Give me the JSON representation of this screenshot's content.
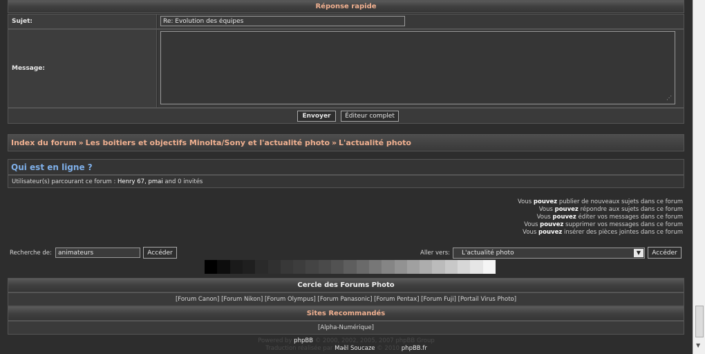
{
  "quick_reply": {
    "title": "Réponse rapide",
    "subject_label": "Sujet:",
    "subject_value": "Re: Evolution des équipes",
    "message_label": "Message:",
    "message_value": "",
    "send_label": "Envoyer",
    "full_editor_label": "Éditeur complet"
  },
  "breadcrumb": {
    "items": [
      "Index du forum",
      "Les boitiers et objectifs Minolta/Sony et l'actualité photo",
      "L'actualité photo"
    ],
    "separator": "»"
  },
  "online": {
    "title": "Qui est en ligne ?",
    "text_prefix": "Utilisateur(s) parcourant ce forum :",
    "users": "Henry 67, pmai",
    "text_suffix": "and 0 invités"
  },
  "permissions": [
    {
      "pre": "Vous",
      "strong": "pouvez",
      "post": "publier de nouveaux sujets dans ce forum"
    },
    {
      "pre": "Vous",
      "strong": "pouvez",
      "post": "répondre aux sujets dans ce forum"
    },
    {
      "pre": "Vous",
      "strong": "pouvez",
      "post": "éditer vos messages dans ce forum"
    },
    {
      "pre": "Vous",
      "strong": "pouvez",
      "post": "supprimer vos messages dans ce forum"
    },
    {
      "pre": "Vous",
      "strong": "pouvez",
      "post": "insérer des pièces jointes dans ce forum"
    }
  ],
  "search": {
    "label": "Recherche de:",
    "value": "animateurs",
    "button": "Accéder"
  },
  "jump": {
    "label": "Aller vers:",
    "selected": "L'actualité photo",
    "button": "Accéder"
  },
  "grayscale": [
    "#000000",
    "#0d0d0d",
    "#1a1a1a",
    "#1f1f1f",
    "#2a2a2a",
    "#303030",
    "#383838",
    "#3d3d3d",
    "#444444",
    "#4a4a4a",
    "#525252",
    "#5e5e5e",
    "#6a6a6a",
    "#777777",
    "#858585",
    "#929292",
    "#a0a0a0",
    "#adadad",
    "#bbbbbb",
    "#c8c8c8",
    "#d7d7d7",
    "#e6e6e6",
    "#f5f5f5"
  ],
  "cercle": {
    "title": "Cercle des Forums Photo",
    "links": [
      "[Forum Canon]",
      "[Forum Nikon]",
      "[Forum Olympus]",
      "[Forum Panasonic]",
      "[Forum Pentax]",
      "[Forum Fuji]",
      "[Portail Virus Photo]"
    ]
  },
  "sites": {
    "title": "Sites Recommandés",
    "links": [
      "[Alpha-Numérique]"
    ]
  },
  "footer": {
    "powered_prefix": "Powered by",
    "phpbb": "phpBB",
    "line1_rest": "© 2000, 2002, 2005, 2007 phpBB Group",
    "translation_prefix": "Traduction réalisée par",
    "translator": "Maël Soucaze",
    "line2_mid": "© 2010",
    "phpbbfr": "phpBB.fr"
  }
}
